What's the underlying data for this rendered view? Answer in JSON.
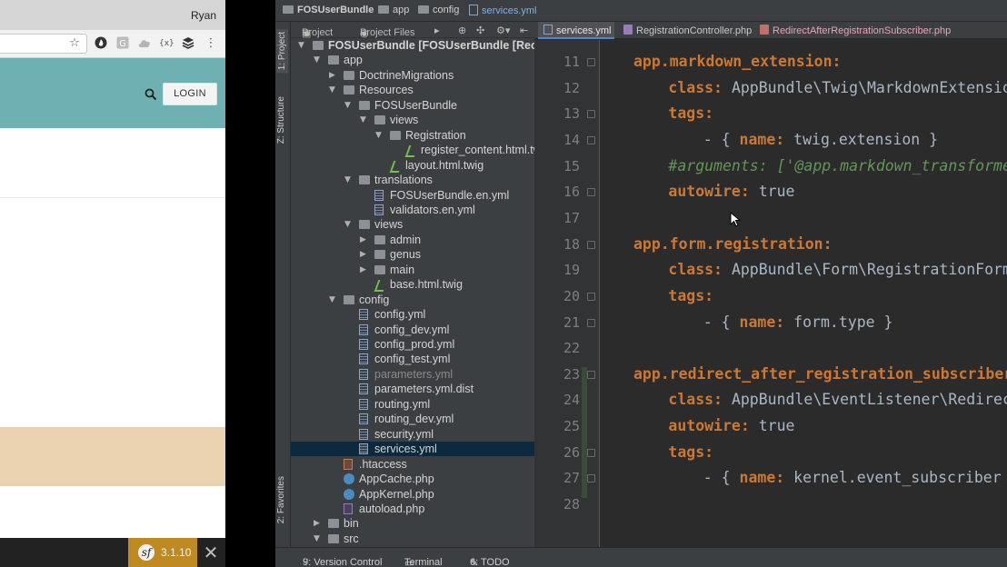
{
  "browser": {
    "user_name": "Ryan",
    "toolbar_icons": [
      "star-icon",
      "flame-icon",
      "extension-g-icon",
      "cloud-icon",
      "braces-icon",
      "layers-icon",
      "more-icon"
    ],
    "login_label": "LOGIN",
    "symfony_version": "3.1.10",
    "close_glyph": "✕"
  },
  "ide": {
    "breadcrumbs": [
      "FOSUserBundle",
      "app",
      "config",
      "services.yml"
    ],
    "side_tabs": [
      "1: Project",
      "Z: Structure",
      "2: Favorites"
    ],
    "panel_toolbar": [
      "Project",
      "Project Files"
    ],
    "tree": [
      {
        "label": "FOSUserBundle [FOSUserBundle [Recordi",
        "type": "folder",
        "depth": 0,
        "arrow": "down",
        "bold": true
      },
      {
        "label": "app",
        "type": "folder",
        "depth": 1,
        "arrow": "down"
      },
      {
        "label": "DoctrineMigrations",
        "type": "folder",
        "depth": 2,
        "arrow": "right"
      },
      {
        "label": "Resources",
        "type": "folder",
        "depth": 2,
        "arrow": "down"
      },
      {
        "label": "FOSUserBundle",
        "type": "folder",
        "depth": 3,
        "arrow": "down"
      },
      {
        "label": "views",
        "type": "folder",
        "depth": 4,
        "arrow": "down"
      },
      {
        "label": "Registration",
        "type": "folder",
        "depth": 5,
        "arrow": "down"
      },
      {
        "label": "register_content.html.tw",
        "type": "twig",
        "depth": 6
      },
      {
        "label": "layout.html.twig",
        "type": "twig",
        "depth": 5
      },
      {
        "label": "translations",
        "type": "folder",
        "depth": 3,
        "arrow": "down"
      },
      {
        "label": "FOSUserBundle.en.yml",
        "type": "yml",
        "depth": 4
      },
      {
        "label": "validators.en.yml",
        "type": "yml",
        "depth": 4
      },
      {
        "label": "views",
        "type": "folder",
        "depth": 3,
        "arrow": "down"
      },
      {
        "label": "admin",
        "type": "folder",
        "depth": 4,
        "arrow": "right"
      },
      {
        "label": "genus",
        "type": "folder",
        "depth": 4,
        "arrow": "right"
      },
      {
        "label": "main",
        "type": "folder",
        "depth": 4,
        "arrow": "right"
      },
      {
        "label": "base.html.twig",
        "type": "twig",
        "depth": 4
      },
      {
        "label": "config",
        "type": "folder",
        "depth": 2,
        "arrow": "down"
      },
      {
        "label": "config.yml",
        "type": "yml",
        "depth": 3
      },
      {
        "label": "config_dev.yml",
        "type": "yml",
        "depth": 3
      },
      {
        "label": "config_prod.yml",
        "type": "yml",
        "depth": 3
      },
      {
        "label": "config_test.yml",
        "type": "yml",
        "depth": 3
      },
      {
        "label": "parameters.yml",
        "type": "yml",
        "depth": 3,
        "dim": true
      },
      {
        "label": "parameters.yml.dist",
        "type": "yml",
        "depth": 3
      },
      {
        "label": "routing.yml",
        "type": "yml",
        "depth": 3
      },
      {
        "label": "routing_dev.yml",
        "type": "yml",
        "depth": 3
      },
      {
        "label": "security.yml",
        "type": "yml",
        "depth": 3
      },
      {
        "label": "services.yml",
        "type": "yml",
        "depth": 3,
        "selected": true
      },
      {
        "label": ".htaccess",
        "type": "htaccess",
        "depth": 2
      },
      {
        "label": "AppCache.php",
        "type": "php",
        "depth": 2
      },
      {
        "label": "AppKernel.php",
        "type": "php",
        "depth": 2
      },
      {
        "label": "autoload.php",
        "type": "php-plain",
        "depth": 2
      },
      {
        "label": "bin",
        "type": "folder",
        "depth": 1,
        "arrow": "right"
      },
      {
        "label": "src",
        "type": "folder",
        "depth": 1,
        "arrow": "down"
      }
    ],
    "editor_tabs": [
      {
        "label": "services.yml",
        "active": true
      },
      {
        "label": "RegistrationController.php"
      },
      {
        "label": "RedirectAfterRegistrationSubscriber.php"
      }
    ],
    "code_lines": [
      {
        "n": "11",
        "indent": 0,
        "segments": [
          {
            "t": "app.markdown_extension:",
            "c": "k"
          }
        ]
      },
      {
        "n": "12",
        "indent": 4,
        "segments": [
          {
            "t": "class: ",
            "c": "k"
          },
          {
            "t": "AppBundle\\Twig\\MarkdownExtension",
            "c": "v"
          }
        ]
      },
      {
        "n": "13",
        "indent": 4,
        "segments": [
          {
            "t": "tags:",
            "c": "k"
          }
        ]
      },
      {
        "n": "14",
        "indent": 8,
        "segments": [
          {
            "t": "- { ",
            "c": "v"
          },
          {
            "t": "name: ",
            "c": "k"
          },
          {
            "t": "twig.extension }",
            "c": "v"
          }
        ]
      },
      {
        "n": "15",
        "indent": 4,
        "segments": [
          {
            "t": "#arguments: ['@app.markdown_transformer",
            "c": "c"
          }
        ]
      },
      {
        "n": "16",
        "indent": 4,
        "segments": [
          {
            "t": "autowire: ",
            "c": "k"
          },
          {
            "t": "true",
            "c": "v"
          }
        ]
      },
      {
        "n": "17",
        "indent": 0,
        "segments": []
      },
      {
        "n": "18",
        "indent": 0,
        "segments": [
          {
            "t": "app.form.registration:",
            "c": "k"
          }
        ]
      },
      {
        "n": "19",
        "indent": 4,
        "segments": [
          {
            "t": "class: ",
            "c": "k"
          },
          {
            "t": "AppBundle\\Form\\RegistrationFormTy",
            "c": "v"
          }
        ]
      },
      {
        "n": "20",
        "indent": 4,
        "segments": [
          {
            "t": "tags:",
            "c": "k"
          }
        ]
      },
      {
        "n": "21",
        "indent": 8,
        "segments": [
          {
            "t": "- { ",
            "c": "v"
          },
          {
            "t": "name: ",
            "c": "k"
          },
          {
            "t": "form.type }",
            "c": "v"
          }
        ]
      },
      {
        "n": "22",
        "indent": 0,
        "segments": []
      },
      {
        "n": "23",
        "indent": 0,
        "segments": [
          {
            "t": "app.redirect_after_registration_subscriber:",
            "c": "k"
          }
        ]
      },
      {
        "n": "24",
        "indent": 4,
        "segments": [
          {
            "t": "class: ",
            "c": "k"
          },
          {
            "t": "AppBundle\\EventListener\\Redirect",
            "c": "v"
          }
        ]
      },
      {
        "n": "25",
        "indent": 4,
        "segments": [
          {
            "t": "autowire: ",
            "c": "k"
          },
          {
            "t": "true",
            "c": "v"
          }
        ]
      },
      {
        "n": "26",
        "indent": 4,
        "segments": [
          {
            "t": "tags:",
            "c": "k"
          }
        ]
      },
      {
        "n": "27",
        "indent": 8,
        "segments": [
          {
            "t": "- { ",
            "c": "v"
          },
          {
            "t": "name: ",
            "c": "k"
          },
          {
            "t": "kernel.event_subscriber }",
            "c": "v"
          }
        ]
      },
      {
        "n": "28",
        "indent": 0,
        "segments": []
      }
    ],
    "bottom_tools": [
      "9: Version Control",
      "Terminal",
      "6: TODO"
    ]
  }
}
